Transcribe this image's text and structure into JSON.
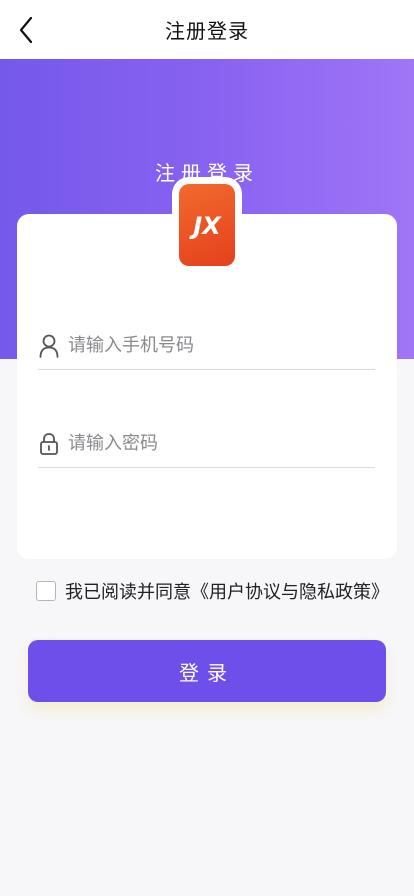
{
  "nav": {
    "title": "注册登录",
    "back_icon": "chevron-left-icon"
  },
  "hero": {
    "title": "注册登录",
    "gradient": [
      "#7559ea",
      "#a076f6"
    ]
  },
  "logo": {
    "text": "JX",
    "color": "#e5401c"
  },
  "form": {
    "phone": {
      "placeholder": "请输入手机号码",
      "value": "",
      "icon": "user-icon"
    },
    "password": {
      "placeholder": "请输入密码",
      "value": "",
      "icon": "lock-icon"
    }
  },
  "agreement": {
    "checked": false,
    "text": "我已阅读并同意",
    "link": "《用户协议与隐私政策》"
  },
  "login_button": {
    "label": "登录",
    "color": "#6f4fea"
  }
}
